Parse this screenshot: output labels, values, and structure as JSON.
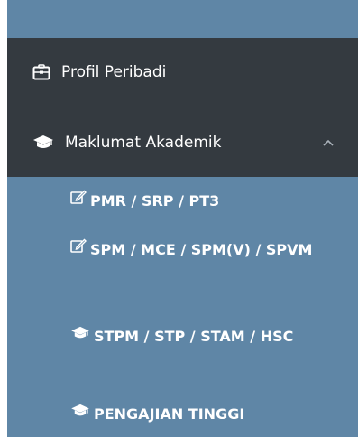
{
  "sidebar": {
    "items": [
      {
        "label": "Profil Peribadi",
        "icon": "id-card-icon"
      },
      {
        "label": "Maklumat Akademik",
        "icon": "graduation-cap-icon",
        "expanded": true
      }
    ],
    "submenu": [
      {
        "label": "PMR / SRP / PT3",
        "icon": "edit-icon"
      },
      {
        "label": "SPM / MCE / SPM(V) / SPVM",
        "icon": "edit-icon"
      },
      {
        "label": "STPM / STP / STAM / HSC",
        "icon": "graduation-cap-icon"
      },
      {
        "label": "PENGAJIAN TINGGI",
        "icon": "graduation-cap-icon"
      }
    ]
  },
  "colors": {
    "panel": "#5f86a6",
    "active_section": "#343a40",
    "text": "#ffffff"
  }
}
